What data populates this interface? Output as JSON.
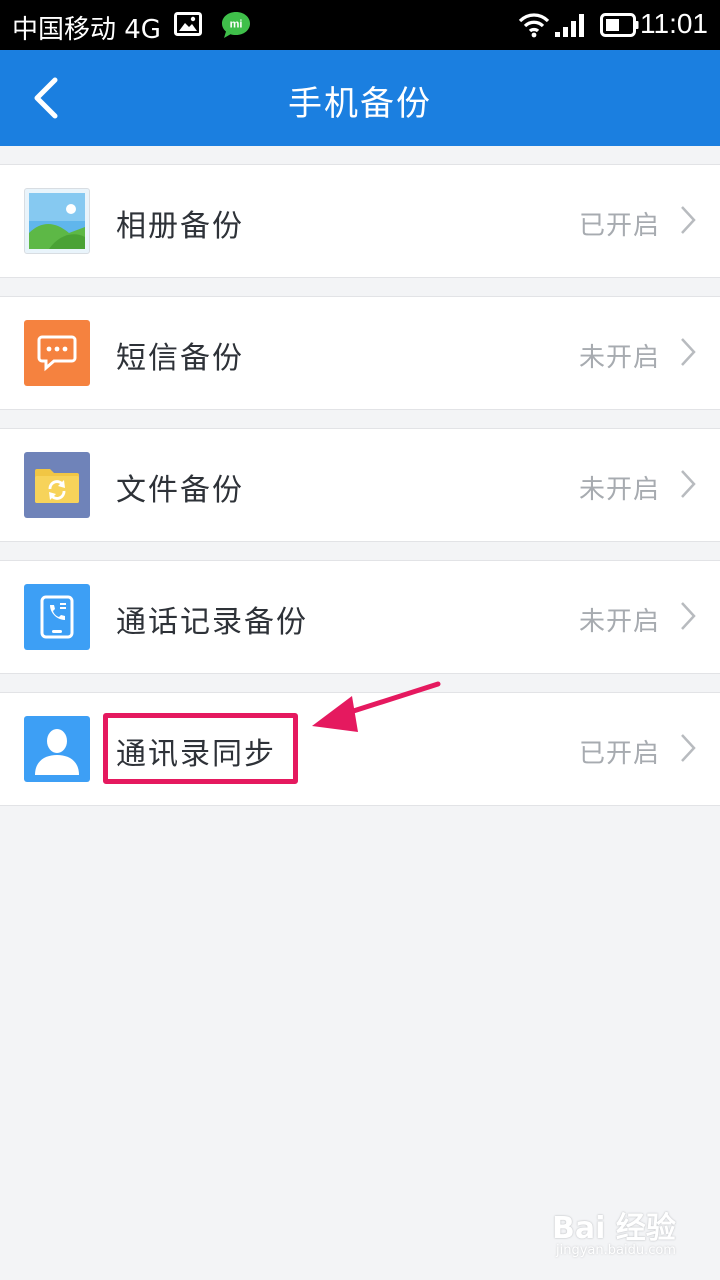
{
  "status_bar": {
    "carrier": "中国移动 4G",
    "time": "11:01"
  },
  "header": {
    "title": "手机备份"
  },
  "items": [
    {
      "label": "相册备份",
      "status": "已开启",
      "icon": "photo-album-icon",
      "icon_color": "#e9f4fb"
    },
    {
      "label": "短信备份",
      "status": "未开启",
      "icon": "sms-icon",
      "icon_color": "#f5823f"
    },
    {
      "label": "文件备份",
      "status": "未开启",
      "icon": "folder-sync-icon",
      "icon_color": "#6f83b9"
    },
    {
      "label": "通话记录备份",
      "status": "未开启",
      "icon": "call-log-icon",
      "icon_color": "#3d9ff5"
    },
    {
      "label": "通讯录同步",
      "status": "已开启",
      "icon": "contacts-icon",
      "icon_color": "#3d9ff5"
    }
  ],
  "watermark": {
    "logo_text": "Bai 经验",
    "url": "jingyan.baidu.com"
  },
  "colors": {
    "accent": "#1b7fe0",
    "annotation": "#e5195f",
    "status_text": "#a7abb0"
  }
}
